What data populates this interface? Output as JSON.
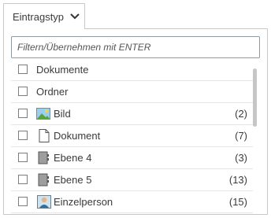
{
  "tab": {
    "label": "Eintragstyp",
    "icon": "chevron-down-icon"
  },
  "filter": {
    "value": "",
    "placeholder": "Filtern/Übernehmen mit ENTER"
  },
  "items": [
    {
      "label": "Dokumente",
      "count": "",
      "icon": ""
    },
    {
      "label": "Ordner",
      "count": "",
      "icon": ""
    },
    {
      "label": "Bild",
      "count": "(2)",
      "icon": "image-icon"
    },
    {
      "label": "Dokument",
      "count": "(7)",
      "icon": "document-icon"
    },
    {
      "label": "Ebene 4",
      "count": "(3)",
      "icon": "folder-level-icon"
    },
    {
      "label": "Ebene 5",
      "count": "(13)",
      "icon": "folder-level-icon"
    },
    {
      "label": "Einzelperson",
      "count": "(15)",
      "icon": "person-icon"
    }
  ],
  "colors": {
    "border": "#c9c9c9",
    "input_border": "#8f9aa3",
    "text": "#3a3a3a",
    "scrollbar": "#c6c6c6"
  }
}
